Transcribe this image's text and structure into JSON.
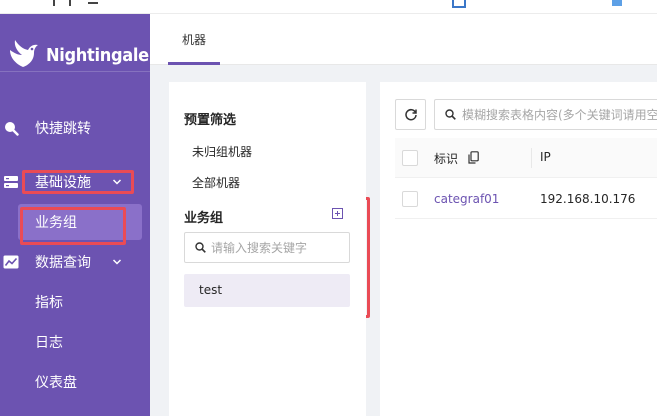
{
  "brand": {
    "name": "Nightingale"
  },
  "colors": {
    "sidebar": "#6c53b1",
    "accent": "#6c53b1",
    "highlight": "#ea4b55",
    "link": "#6c53b1"
  },
  "sidebar": {
    "items": [
      {
        "label": "快捷跳转",
        "icon": "search-icon"
      },
      {
        "label": "基础设施",
        "icon": "server-icon",
        "expanded": true
      },
      {
        "label": "业务组",
        "sub": true,
        "active": true
      },
      {
        "label": "数据查询",
        "icon": "chart-line-icon",
        "expanded": true
      },
      {
        "label": "指标",
        "sub": true
      },
      {
        "label": "日志",
        "sub": true
      },
      {
        "label": "仪表盘",
        "sub": true
      }
    ]
  },
  "header": {
    "tabs": [
      {
        "label": "机器",
        "active": true
      }
    ]
  },
  "filter": {
    "preset_title": "预置筛选",
    "preset_items": [
      "未归组机器",
      "全部机器"
    ],
    "group_title": "业务组",
    "search_placeholder": "请输入搜索关键字",
    "groups": [
      "test"
    ]
  },
  "table": {
    "search_placeholder": "模糊搜索表格内容(多个关键词请用空",
    "columns": [
      "标识",
      "IP"
    ],
    "rows": [
      {
        "ident": "categraf01",
        "ip": "192.168.10.176"
      }
    ]
  }
}
